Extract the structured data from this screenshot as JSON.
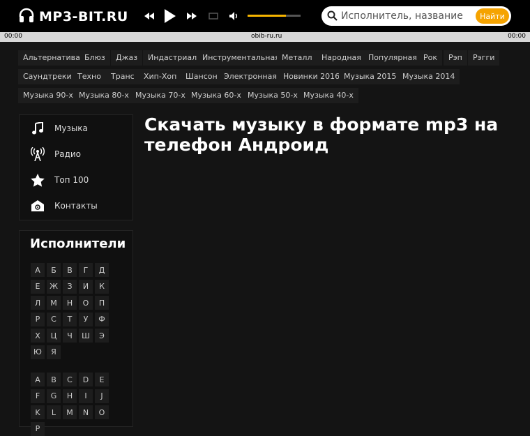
{
  "header": {
    "logo_text": "MP3-BIT.RU",
    "volume_percent": 73,
    "search_placeholder": "Исполнитель, название или текст",
    "search_button": "Найти"
  },
  "player": {
    "time_left": "00:00",
    "track_label": "obib-ru.ru",
    "time_right": "00:00"
  },
  "genres": [
    "Альтернатива",
    "Блюз",
    "Джаз",
    "Индастриал",
    "Инструментальная",
    "Металл",
    "Народная",
    "Популярная",
    "Рок",
    "Рэп",
    "Рэгги",
    "Саундтреки",
    "Техно",
    "Транс",
    "Хип-Хоп",
    "Шансон",
    "Электронная",
    "Новинки 2016",
    "Музыка 2015",
    "Музыка 2014",
    "Музыка 90-х",
    "Музыка 80-х",
    "Музыка 70-х",
    "Музыка 60-х",
    "Музыка 50-х",
    "Музыка 40-х"
  ],
  "nav": [
    {
      "label": "Музыка",
      "icon": "music-note-icon"
    },
    {
      "label": "Радио",
      "icon": "radio-tower-icon"
    },
    {
      "label": "Топ 100",
      "icon": "star-icon"
    },
    {
      "label": "Контакты",
      "icon": "contact-mail-icon"
    }
  ],
  "artists": {
    "title": "Исполнители",
    "cyrillic": [
      "А",
      "Б",
      "В",
      "Г",
      "Д",
      "Е",
      "Ж",
      "З",
      "И",
      "К",
      "Л",
      "М",
      "Н",
      "О",
      "П",
      "Р",
      "С",
      "Т",
      "У",
      "Ф",
      "Х",
      "Ц",
      "Ч",
      "Ш",
      "Э",
      "Ю",
      "Я"
    ],
    "latin": [
      "A",
      "B",
      "C",
      "D",
      "E",
      "F",
      "G",
      "H",
      "I",
      "J",
      "K",
      "L",
      "M",
      "N",
      "O",
      "P"
    ]
  },
  "main": {
    "title": "Скачать музыку в формате mp3 на телефон Андроид"
  }
}
